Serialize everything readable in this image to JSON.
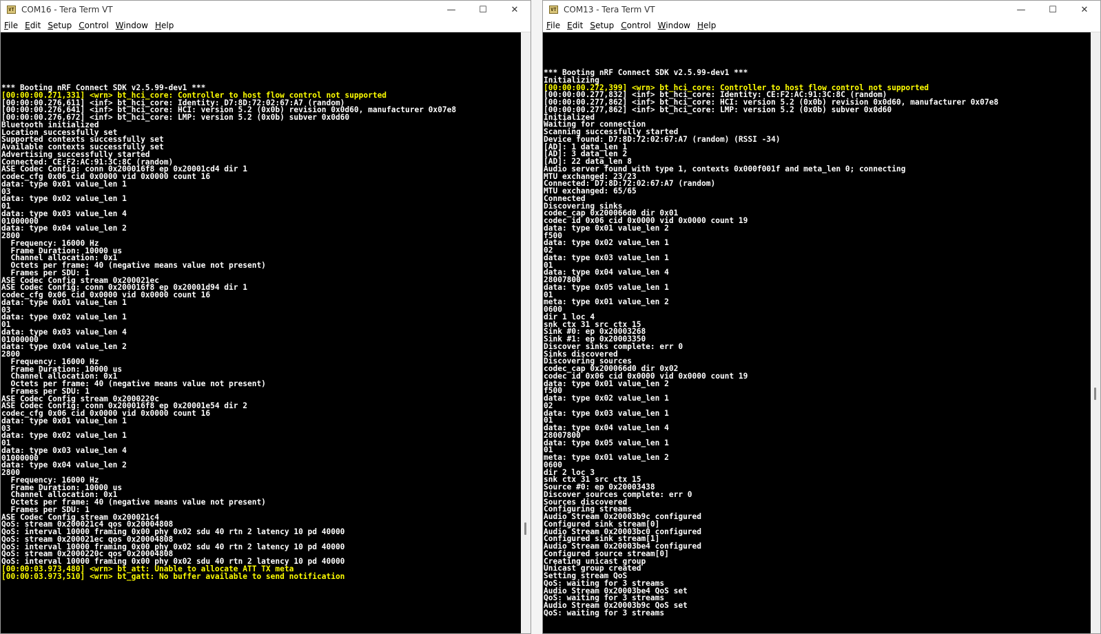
{
  "windows": [
    {
      "title": "COM16 - Tera Term VT",
      "menu": [
        "File",
        "Edit",
        "Setup",
        "Control",
        "Window",
        "Help"
      ],
      "lines": [
        {
          "t": "*** Booting nRF Connect SDK v2.5.99-dev1 ***"
        },
        {
          "t": "[00:00:00.271,331] <wrn> bt_hci_core: Controller to host flow control not supported",
          "w": true
        },
        {
          "t": "[00:00:00.276,611] <inf> bt_hci_core: Identity: D7:8D:72:02:67:A7 (random)"
        },
        {
          "t": "[00:00:00.276,641] <inf> bt_hci_core: HCI: version 5.2 (0x0b) revision 0x0d60, manufacturer 0x07e8"
        },
        {
          "t": "[00:00:00.276,672] <inf> bt_hci_core: LMP: version 5.2 (0x0b) subver 0x0d60"
        },
        {
          "t": "Bluetooth initialized"
        },
        {
          "t": "Location successfully set"
        },
        {
          "t": "Supported contexts successfully set"
        },
        {
          "t": "Available contexts successfully set"
        },
        {
          "t": "Advertising successfully started"
        },
        {
          "t": "Connected: CE:F2:AC:91:3C:8C (random)"
        },
        {
          "t": "ASE Codec Config: conn 0x200016f8 ep 0x20001cd4 dir 1"
        },
        {
          "t": "codec_cfg 0x06 cid 0x0000 vid 0x0000 count 16"
        },
        {
          "t": "data: type 0x01 value_len 1"
        },
        {
          "t": "03"
        },
        {
          "t": "data: type 0x02 value_len 1"
        },
        {
          "t": "01"
        },
        {
          "t": "data: type 0x03 value_len 4"
        },
        {
          "t": "01000000"
        },
        {
          "t": "data: type 0x04 value_len 2"
        },
        {
          "t": "2800"
        },
        {
          "t": "  Frequency: 16000 Hz"
        },
        {
          "t": "  Frame Duration: 10000 us"
        },
        {
          "t": "  Channel allocation: 0x1"
        },
        {
          "t": "  Octets per frame: 40 (negative means value not present)"
        },
        {
          "t": "  Frames per SDU: 1"
        },
        {
          "t": "ASE Codec Config stream 0x200021ec"
        },
        {
          "t": "ASE Codec Config: conn 0x200016f8 ep 0x20001d94 dir 1"
        },
        {
          "t": "codec_cfg 0x06 cid 0x0000 vid 0x0000 count 16"
        },
        {
          "t": "data: type 0x01 value_len 1"
        },
        {
          "t": "03"
        },
        {
          "t": "data: type 0x02 value_len 1"
        },
        {
          "t": "01"
        },
        {
          "t": "data: type 0x03 value_len 4"
        },
        {
          "t": "01000000"
        },
        {
          "t": "data: type 0x04 value_len 2"
        },
        {
          "t": "2800"
        },
        {
          "t": "  Frequency: 16000 Hz"
        },
        {
          "t": "  Frame Duration: 10000 us"
        },
        {
          "t": "  Channel allocation: 0x1"
        },
        {
          "t": "  Octets per frame: 40 (negative means value not present)"
        },
        {
          "t": "  Frames per SDU: 1"
        },
        {
          "t": "ASE Codec Config stream 0x2000220c"
        },
        {
          "t": "ASE Codec Config: conn 0x200016f8 ep 0x20001e54 dir 2"
        },
        {
          "t": "codec_cfg 0x06 cid 0x0000 vid 0x0000 count 16"
        },
        {
          "t": "data: type 0x01 value_len 1"
        },
        {
          "t": "03"
        },
        {
          "t": "data: type 0x02 value_len 1"
        },
        {
          "t": "01"
        },
        {
          "t": "data: type 0x03 value_len 4"
        },
        {
          "t": "01000000"
        },
        {
          "t": "data: type 0x04 value_len 2"
        },
        {
          "t": "2800"
        },
        {
          "t": "  Frequency: 16000 Hz"
        },
        {
          "t": "  Frame Duration: 10000 us"
        },
        {
          "t": "  Channel allocation: 0x1"
        },
        {
          "t": "  Octets per frame: 40 (negative means value not present)"
        },
        {
          "t": "  Frames per SDU: 1"
        },
        {
          "t": "ASE Codec Config stream 0x200021c4"
        },
        {
          "t": "QoS: stream 0x200021c4 qos 0x20004808"
        },
        {
          "t": "QoS: interval 10000 framing 0x00 phy 0x02 sdu 40 rtn 2 latency 10 pd 40000"
        },
        {
          "t": "QoS: stream 0x200021ec qos 0x20004808"
        },
        {
          "t": "QoS: interval 10000 framing 0x00 phy 0x02 sdu 40 rtn 2 latency 10 pd 40000"
        },
        {
          "t": "QoS: stream 0x2000220c qos 0x20004808"
        },
        {
          "t": "QoS: interval 10000 framing 0x00 phy 0x02 sdu 40 rtn 2 latency 10 pd 40000"
        },
        {
          "t": "[00:00:03.973,480] <wrn> bt_att: Unable to allocate ATT TX meta",
          "w": true
        },
        {
          "t": "[00:00:03.973,510] <wrn> bt_gatt: No buffer available to send notification",
          "w": true
        }
      ]
    },
    {
      "title": "COM13 - Tera Term VT",
      "menu": [
        "File",
        "Edit",
        "Setup",
        "Control",
        "Window",
        "Help"
      ],
      "lines": [
        {
          "t": "*** Booting nRF Connect SDK v2.5.99-dev1 ***"
        },
        {
          "t": "Initializing"
        },
        {
          "t": "[00:00:00.272,399] <wrn> bt_hci_core: Controller to host flow control not supported",
          "w": true
        },
        {
          "t": "[00:00:00.277,832] <inf> bt_hci_core: Identity: CE:F2:AC:91:3C:8C (random)"
        },
        {
          "t": "[00:00:00.277,862] <inf> bt_hci_core: HCI: version 5.2 (0x0b) revision 0x0d60, manufacturer 0x07e8"
        },
        {
          "t": "[00:00:00.277,862] <inf> bt_hci_core: LMP: version 5.2 (0x0b) subver 0x0d60"
        },
        {
          "t": "Initialized"
        },
        {
          "t": "Waiting for connection"
        },
        {
          "t": "Scanning successfully started"
        },
        {
          "t": "Device found: D7:8D:72:02:67:A7 (random) (RSSI -34)"
        },
        {
          "t": "[AD]: 1 data_len 1"
        },
        {
          "t": "[AD]: 3 data_len 2"
        },
        {
          "t": "[AD]: 22 data_len 8"
        },
        {
          "t": "Audio server found with type 1, contexts 0x000f001f and meta_len 0; connecting"
        },
        {
          "t": "MTU exchanged: 23/23"
        },
        {
          "t": "Connected: D7:8D:72:02:67:A7 (random)"
        },
        {
          "t": "MTU exchanged: 65/65"
        },
        {
          "t": "Connected"
        },
        {
          "t": "Discovering sinks"
        },
        {
          "t": "codec_cap 0x200066d0 dir 0x01"
        },
        {
          "t": "codec id 0x06 cid 0x0000 vid 0x0000 count 19"
        },
        {
          "t": "data: type 0x01 value_len 2"
        },
        {
          "t": "f500"
        },
        {
          "t": "data: type 0x02 value_len 1"
        },
        {
          "t": "02"
        },
        {
          "t": "data: type 0x03 value_len 1"
        },
        {
          "t": "01"
        },
        {
          "t": "data: type 0x04 value_len 4"
        },
        {
          "t": "28007800"
        },
        {
          "t": "data: type 0x05 value_len 1"
        },
        {
          "t": "01"
        },
        {
          "t": "meta: type 0x01 value_len 2"
        },
        {
          "t": "0600"
        },
        {
          "t": "dir 1 loc 4"
        },
        {
          "t": "snk ctx 31 src ctx 15"
        },
        {
          "t": "Sink #0: ep 0x20003268"
        },
        {
          "t": "Sink #1: ep 0x20003350"
        },
        {
          "t": "Discover sinks complete: err 0"
        },
        {
          "t": "Sinks discovered"
        },
        {
          "t": "Discovering sources"
        },
        {
          "t": "codec_cap 0x200066d0 dir 0x02"
        },
        {
          "t": "codec id 0x06 cid 0x0000 vid 0x0000 count 19"
        },
        {
          "t": "data: type 0x01 value_len 2"
        },
        {
          "t": "f500"
        },
        {
          "t": "data: type 0x02 value_len 1"
        },
        {
          "t": "02"
        },
        {
          "t": "data: type 0x03 value_len 1"
        },
        {
          "t": "01"
        },
        {
          "t": "data: type 0x04 value_len 4"
        },
        {
          "t": "28007800"
        },
        {
          "t": "data: type 0x05 value_len 1"
        },
        {
          "t": "01"
        },
        {
          "t": "meta: type 0x01 value_len 2"
        },
        {
          "t": "0600"
        },
        {
          "t": "dir 2 loc 3"
        },
        {
          "t": "snk ctx 31 src ctx 15"
        },
        {
          "t": "Source #0: ep 0x20003438"
        },
        {
          "t": "Discover sources complete: err 0"
        },
        {
          "t": "Sources discovered"
        },
        {
          "t": "Configuring streams"
        },
        {
          "t": "Audio Stream 0x20003b9c configured"
        },
        {
          "t": "Configured sink stream[0]"
        },
        {
          "t": "Audio Stream 0x20003bc0 configured"
        },
        {
          "t": "Configured sink stream[1]"
        },
        {
          "t": "Audio Stream 0x20003be4 configured"
        },
        {
          "t": "Configured source stream[0]"
        },
        {
          "t": "Creating unicast group"
        },
        {
          "t": "Unicast group created"
        },
        {
          "t": "Setting stream QoS"
        },
        {
          "t": "QoS: waiting for 3 streams"
        },
        {
          "t": "Audio Stream 0x20003be4 QoS set"
        },
        {
          "t": "QoS: waiting for 3 streams"
        },
        {
          "t": "Audio Stream 0x20003b9c QoS set"
        },
        {
          "t": "QoS: waiting for 3 streams"
        }
      ]
    }
  ],
  "icons": {
    "app": "teraterm-icon",
    "minimize": "minimize-icon",
    "maximize": "maximize-icon",
    "close": "close-icon"
  },
  "icon_glyphs": {
    "app": "VT",
    "minimize": "—",
    "maximize": "☐",
    "close": "✕"
  },
  "colors": {
    "terminal_bg": "#000000",
    "terminal_fg": "#ffffff",
    "warn_fg": "#ffff00"
  }
}
